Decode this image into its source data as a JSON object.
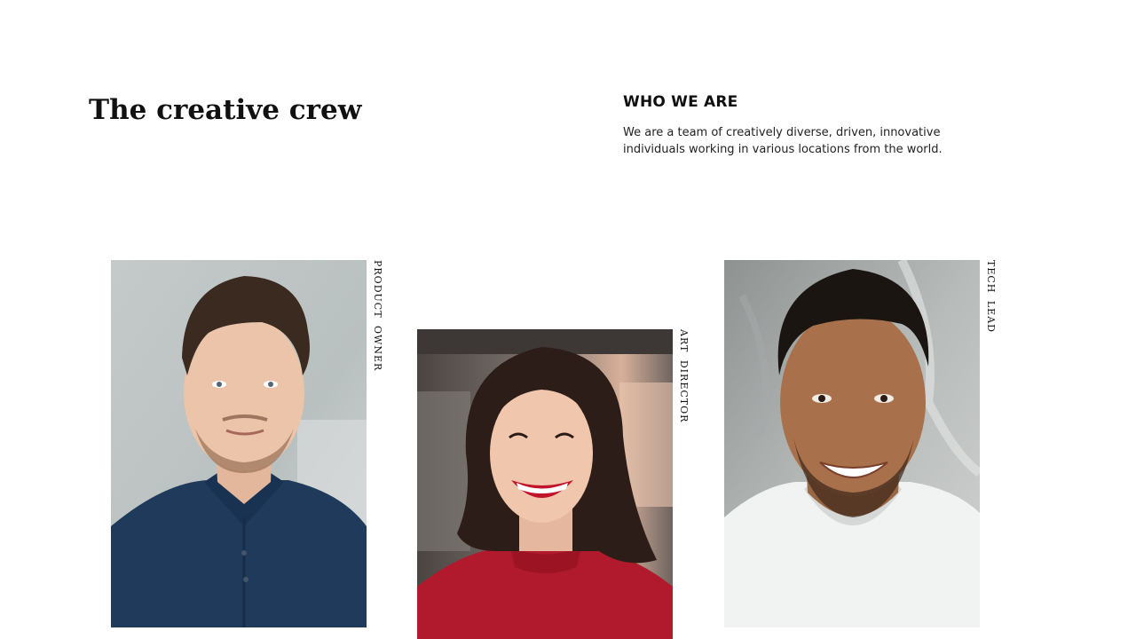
{
  "header": {
    "title": "The creative crew"
  },
  "intro": {
    "heading": "WHO WE ARE",
    "text": "We are a team of creatively diverse, driven, innovative individuals working in various locations from the world."
  },
  "team": [
    {
      "role": "PRODUCT OWNER",
      "photo_icon": "man-in-navy-polo-photo"
    },
    {
      "role": "ART DIRECTOR",
      "photo_icon": "smiling-woman-red-top-photo"
    },
    {
      "role": "TECH LEAD",
      "photo_icon": "smiling-man-white-tshirt-photo"
    }
  ]
}
